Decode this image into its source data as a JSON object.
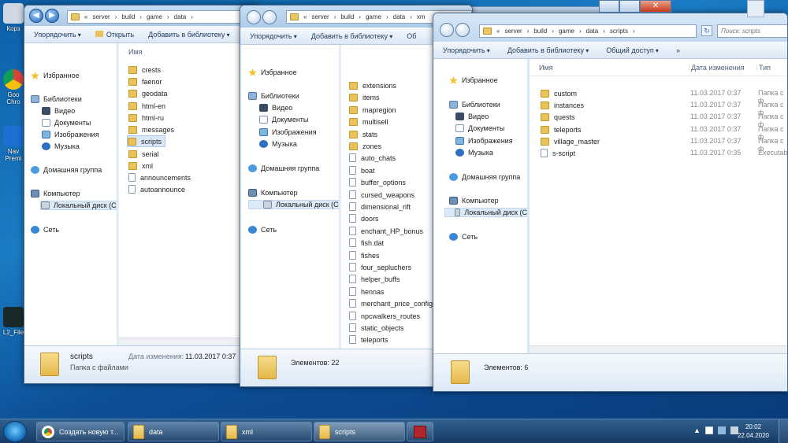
{
  "desktop": {
    "icons": [
      {
        "label": "Корз",
        "icon": "recycle-bin-icon"
      },
      {
        "label": "Goo Chro",
        "icon": "chrome-icon"
      },
      {
        "label": "Nav Premi",
        "icon": "app-icon"
      },
      {
        "label": "L2_File",
        "icon": "game-icon"
      }
    ]
  },
  "nav_common": {
    "favorites": "Избранное",
    "libraries": "Библиотеки",
    "video": "Видео",
    "documents": "Документы",
    "images": "Изображения",
    "music": "Музыка",
    "homegroup": "Домашняя группа",
    "computer": "Компьютер",
    "local_disk": "Локальный диск (C",
    "network": "Сеть"
  },
  "toolbar_common": {
    "organize": "Упорядочить",
    "add_library": "Добавить в библиотеку",
    "share": "Общий доступ",
    "open": "Открыть",
    "more": "»"
  },
  "windows": {
    "data": {
      "path": [
        "«",
        "server",
        "build",
        "game",
        "data"
      ],
      "column_name": "Имя",
      "items": [
        {
          "name": "crests",
          "type": "folder"
        },
        {
          "name": "faenor",
          "type": "folder"
        },
        {
          "name": "geodata",
          "type": "folder"
        },
        {
          "name": "html-en",
          "type": "folder"
        },
        {
          "name": "html-ru",
          "type": "folder"
        },
        {
          "name": "messages",
          "type": "folder"
        },
        {
          "name": "scripts",
          "type": "folder",
          "selected": true
        },
        {
          "name": "serial",
          "type": "folder"
        },
        {
          "name": "xml",
          "type": "folder"
        },
        {
          "name": "announcements",
          "type": "file"
        },
        {
          "name": "autoannounce",
          "type": "file"
        }
      ],
      "details": {
        "name": "scripts",
        "type": "Папка с файлами",
        "date_label": "Дата изменения:",
        "date": "11.03.2017 0:37"
      }
    },
    "xml": {
      "path": [
        "«",
        "server",
        "build",
        "game",
        "data",
        "xm"
      ],
      "items": [
        {
          "name": "extensions",
          "type": "folder"
        },
        {
          "name": "items",
          "type": "folder"
        },
        {
          "name": "mapregion",
          "type": "folder"
        },
        {
          "name": "multisell",
          "type": "folder"
        },
        {
          "name": "stats",
          "type": "folder"
        },
        {
          "name": "zones",
          "type": "folder"
        },
        {
          "name": "auto_chats",
          "type": "file"
        },
        {
          "name": "boat",
          "type": "file"
        },
        {
          "name": "buffer_options",
          "type": "file"
        },
        {
          "name": "cursed_weapons",
          "type": "file"
        },
        {
          "name": "dimensional_rift",
          "type": "file"
        },
        {
          "name": "doors",
          "type": "file"
        },
        {
          "name": "enchant_HP_bonus",
          "type": "file"
        },
        {
          "name": "fish.dat",
          "type": "file"
        },
        {
          "name": "fishes",
          "type": "file"
        },
        {
          "name": "four_sepluchers",
          "type": "file"
        },
        {
          "name": "helper_buffs",
          "type": "file"
        },
        {
          "name": "hennas",
          "type": "file"
        },
        {
          "name": "merchant_price_config",
          "type": "file"
        },
        {
          "name": "npcwalkers_routes",
          "type": "file"
        },
        {
          "name": "static_objects",
          "type": "file"
        },
        {
          "name": "teleports",
          "type": "file"
        }
      ],
      "details": {
        "count": "Элементов: 22"
      },
      "toolbar_cut": "Об"
    },
    "scripts": {
      "path": [
        "«",
        "server",
        "build",
        "game",
        "data",
        "scripts"
      ],
      "search_placeholder": "Поиск: scripts",
      "columns": {
        "name": "Имя",
        "date": "Дата изменения",
        "type": "Тип"
      },
      "items": [
        {
          "name": "custom",
          "type": "folder",
          "date": "11.03.2017 0:37",
          "kind": "Папка с ф"
        },
        {
          "name": "instances",
          "type": "folder",
          "date": "11.03.2017 0:37",
          "kind": "Папка с ф"
        },
        {
          "name": "quests",
          "type": "folder",
          "date": "11.03.2017 0:37",
          "kind": "Папка с ф"
        },
        {
          "name": "teleports",
          "type": "folder",
          "date": "11.03.2017 0:37",
          "kind": "Папка с ф"
        },
        {
          "name": "village_master",
          "type": "folder",
          "date": "11.03.2017 0:37",
          "kind": "Папка с ф"
        },
        {
          "name": "s-script",
          "type": "file",
          "date": "11.03.2017 0:35",
          "kind": "Executabl"
        }
      ],
      "details": {
        "count": "Элементов: 6"
      }
    }
  },
  "taskbar": {
    "buttons": [
      {
        "label": "Создать новую т...",
        "icon": "chrome-icon"
      },
      {
        "label": "data",
        "icon": "folder-icon"
      },
      {
        "label": "xml",
        "icon": "folder-icon"
      },
      {
        "label": "scripts",
        "icon": "folder-icon"
      },
      {
        "label": "",
        "icon": "game-icon"
      }
    ],
    "time": "20:02",
    "date": "22.04.2020"
  },
  "colors": {
    "accent": "#1a7cc4",
    "folder": "#e9c35a",
    "selection": "#d9e8f8"
  }
}
